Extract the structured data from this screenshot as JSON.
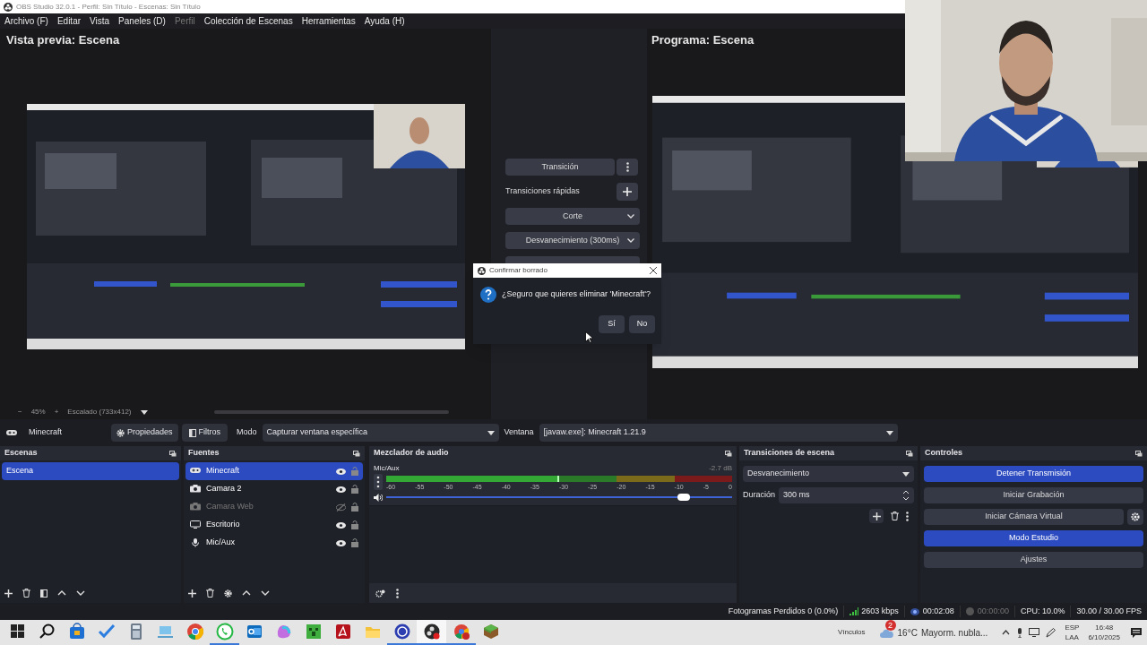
{
  "title_bar": {
    "title": "OBS Studio 32.0.1 - Perfil: Sin Título - Escenas: Sin Título"
  },
  "menu": [
    {
      "label": "Archivo (F)",
      "disabled": false
    },
    {
      "label": "Editar",
      "disabled": false
    },
    {
      "label": "Vista",
      "disabled": false
    },
    {
      "label": "Paneles (D)",
      "disabled": false
    },
    {
      "label": "Perfil",
      "disabled": true
    },
    {
      "label": "Colección de Escenas",
      "disabled": false
    },
    {
      "label": "Herramientas",
      "disabled": false
    },
    {
      "label": "Ayuda (H)",
      "disabled": false
    }
  ],
  "preview": {
    "label": "Vista previa: Escena",
    "zoom_out": "−",
    "zoom": "45%",
    "zoom_in": "+",
    "scaling": "Escalado (733x412)"
  },
  "transitions_panel": {
    "transition_button": "Transición",
    "quick_label": "Transiciones rápidas",
    "quick": [
      "Corte",
      "Desvanecimiento (300ms)"
    ]
  },
  "program": {
    "label": "Programa: Escena"
  },
  "source_toolbar": {
    "source": "Minecraft",
    "properties": "Propiedades",
    "filters": "Filtros",
    "mode_label": "Modo",
    "mode_value": "Capturar ventana específica",
    "window_label": "Ventana",
    "window_value": "[javaw.exe]: Minecraft 1.21.9"
  },
  "scenes": {
    "title": "Escenas",
    "items": [
      {
        "label": "Escena",
        "selected": true
      }
    ]
  },
  "sources": {
    "title": "Fuentes",
    "items": [
      {
        "label": "Minecraft",
        "kind": "game",
        "visible": true,
        "locked": false,
        "selected": true
      },
      {
        "label": "Camara 2",
        "kind": "camera",
        "visible": true,
        "locked": false,
        "selected": false
      },
      {
        "label": "Camara Web",
        "kind": "camera",
        "visible": false,
        "locked": false,
        "selected": false
      },
      {
        "label": "Escritorio",
        "kind": "display",
        "visible": true,
        "locked": false,
        "selected": false
      },
      {
        "label": "Mic/Aux",
        "kind": "mic",
        "visible": true,
        "locked": false,
        "selected": false
      }
    ]
  },
  "mixer": {
    "title": "Mezclador de audio",
    "channels": [
      {
        "name": "Mic/Aux",
        "reading": "-2.7 dB",
        "level": 0.5,
        "volume": {
          "level": 0.86
        },
        "scale": [
          "-60",
          "-55",
          "-50",
          "-45",
          "-40",
          "-35",
          "-30",
          "-25",
          "-20",
          "-15",
          "-10",
          "-5",
          "0"
        ]
      }
    ]
  },
  "scene_transitions": {
    "title": "Transiciones de escena",
    "type": "Desvanecimiento",
    "duration_label": "Duración",
    "duration": "300 ms"
  },
  "controls": {
    "title": "Controles",
    "buttons": [
      {
        "label": "Detener Transmisión",
        "active": true
      },
      {
        "label": "Iniciar Grabación",
        "active": false
      },
      {
        "label": "Iniciar Cámara Virtual",
        "active": false,
        "kind": "with_settings"
      },
      {
        "label": "Modo Estudio",
        "active": true
      },
      {
        "label": "Ajustes",
        "active": false
      }
    ]
  },
  "status_bar": {
    "dropped": "Fotogramas Perdidos 0 (0.0%)",
    "bitrate": "2603 kbps",
    "stream_time": "00:02:08",
    "rec_time": "00:00:00",
    "cpu": "CPU: 10.0%",
    "fps": "30.00 / 30.00 FPS"
  },
  "dialog": {
    "title": "Confirmar borrado",
    "message": "¿Seguro que quieres eliminar 'Minecraft'?",
    "buttons": [
      "Sí",
      "No"
    ]
  },
  "taskbar": {
    "apps": [
      {
        "kind": "start",
        "running": false,
        "focused": false
      },
      {
        "kind": "search",
        "running": false,
        "focused": false
      },
      {
        "kind": "store",
        "running": false,
        "focused": false
      },
      {
        "kind": "todo",
        "running": false,
        "focused": false
      },
      {
        "kind": "calculator",
        "running": false,
        "focused": false
      },
      {
        "kind": "remote",
        "running": false,
        "focused": false
      },
      {
        "kind": "browser",
        "running": false,
        "focused": false
      },
      {
        "kind": "chat",
        "running": true,
        "focused": false
      },
      {
        "kind": "mail",
        "running": false,
        "focused": false
      },
      {
        "kind": "blob",
        "running": false,
        "focused": false
      },
      {
        "kind": "greenblock",
        "running": false,
        "focused": false
      },
      {
        "kind": "pdf",
        "running": false,
        "focused": false
      },
      {
        "kind": "folder",
        "running": false,
        "focused": false
      },
      {
        "kind": "ring",
        "running": true,
        "focused": false
      },
      {
        "kind": "disc",
        "running": true,
        "focused": true
      },
      {
        "kind": "browser_badge",
        "running": true,
        "focused": false
      },
      {
        "kind": "cube",
        "running": false,
        "focused": false
      }
    ],
    "links": "Vínculos",
    "weather_badge": "2",
    "temperature": "16°C",
    "weather": "Mayorm. nubla...",
    "lang": "ESP",
    "layout": "LAA",
    "time": "16:48",
    "date": "6/10/2025"
  }
}
